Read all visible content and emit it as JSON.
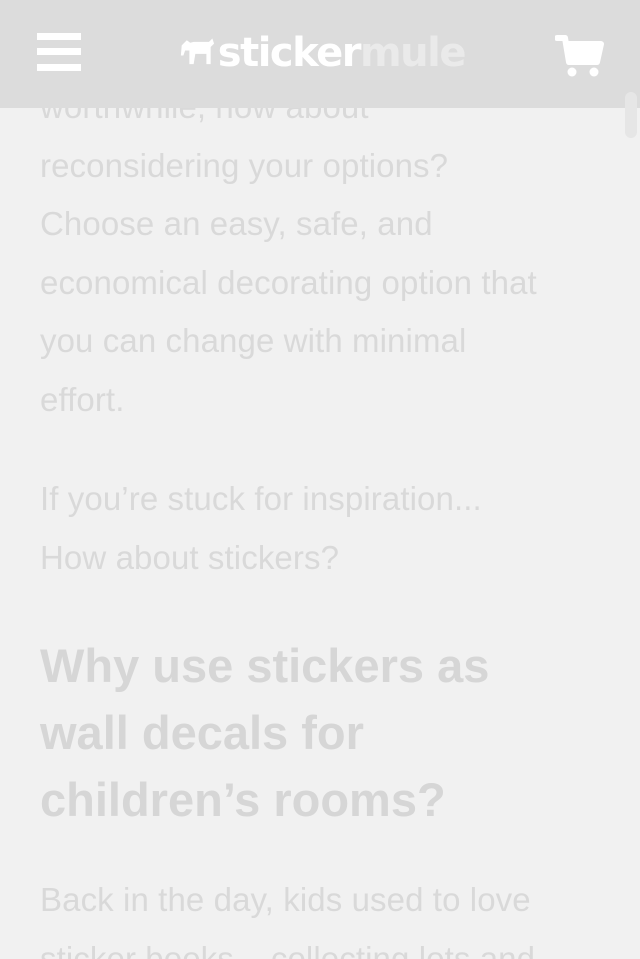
{
  "header": {
    "menu_icon": "hamburger-menu-icon",
    "logo": {
      "icon": "mule-logo-icon",
      "word_1": "sticker",
      "word_2": "mule"
    },
    "cart_icon": "shopping-cart-icon"
  },
  "article": {
    "paragraph_1_lines": [
      "worthwhile, how about",
      "reconsidering your options?",
      "Choose an easy, safe, and",
      "economical decorating option that",
      "you can change with minimal",
      "effort."
    ],
    "paragraph_2_lines": [
      "If you’re stuck for inspiration...",
      "How about stickers?"
    ],
    "heading_lines": [
      "Why use stickers as",
      "wall decals for",
      "children’s rooms?"
    ],
    "paragraph_3_lines": [
      "Back in the day, kids used to love",
      "sticker books – collecting lots and"
    ]
  },
  "colors": {
    "header_background": "#dcdcdc",
    "page_background": "#f1f1f1",
    "text": "#d9d9d9"
  }
}
